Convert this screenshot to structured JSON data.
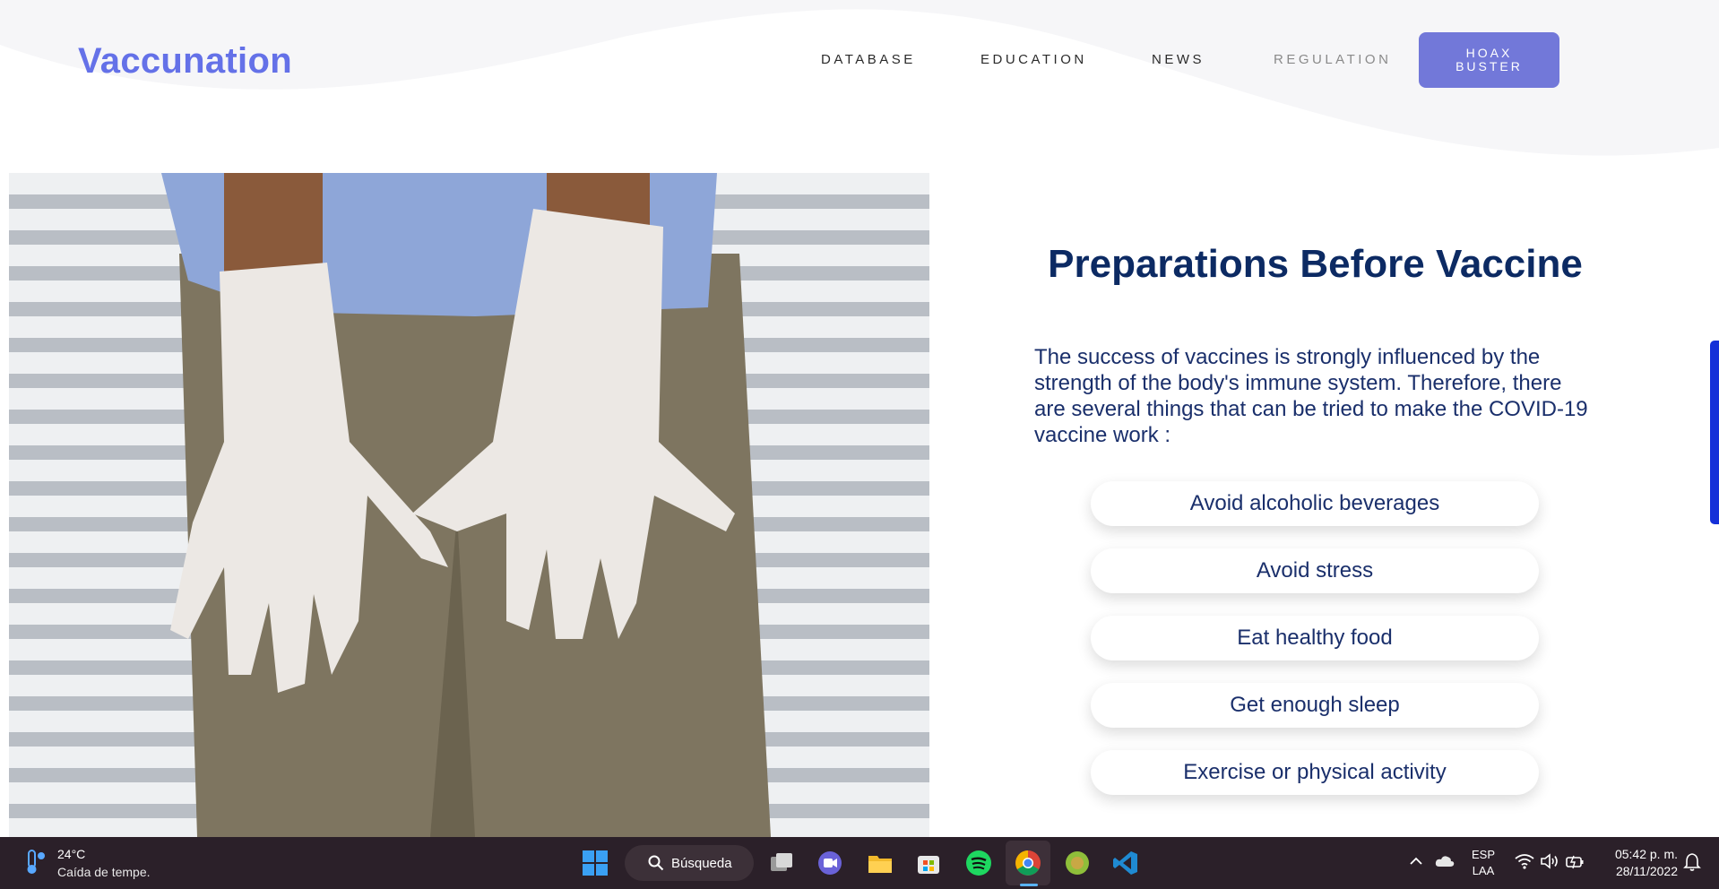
{
  "header": {
    "brand": "Vaccunation",
    "nav": [
      "DATABASE",
      "EDUCATION",
      "NEWS",
      "REGULATION"
    ],
    "cta_line1": "HOAX",
    "cta_line2": "BUSTER"
  },
  "main": {
    "title": "Preparations Before Vaccine",
    "intro": "The success of vaccines is strongly influenced by the strength of the body's immune system. Therefore, there are several things that can be tried to make the COVID-19 vaccine work :",
    "tips": [
      "Avoid alcoholic beverages",
      "Avoid stress",
      "Eat healthy food",
      "Get enough sleep",
      "Exercise or physical activity"
    ]
  },
  "colors": {
    "brand": "#6471e8",
    "heading": "#0c2a63",
    "cta": "#7278d9",
    "scroll": "#1530d8",
    "taskbar": "#2b2029"
  },
  "taskbar": {
    "weather_temp": "24°C",
    "weather_desc": "Caída de tempe.",
    "search_label": "Búsqueda",
    "apps": [
      "windows-start-icon",
      "task-view-icon",
      "chat-icon",
      "file-explorer-icon",
      "store-icon",
      "spotify-icon",
      "chrome-icon",
      "app-icon",
      "vscode-icon"
    ],
    "lang_line1": "ESP",
    "lang_line2": "LAA",
    "time": "05:42 p. m.",
    "date": "28/11/2022"
  }
}
